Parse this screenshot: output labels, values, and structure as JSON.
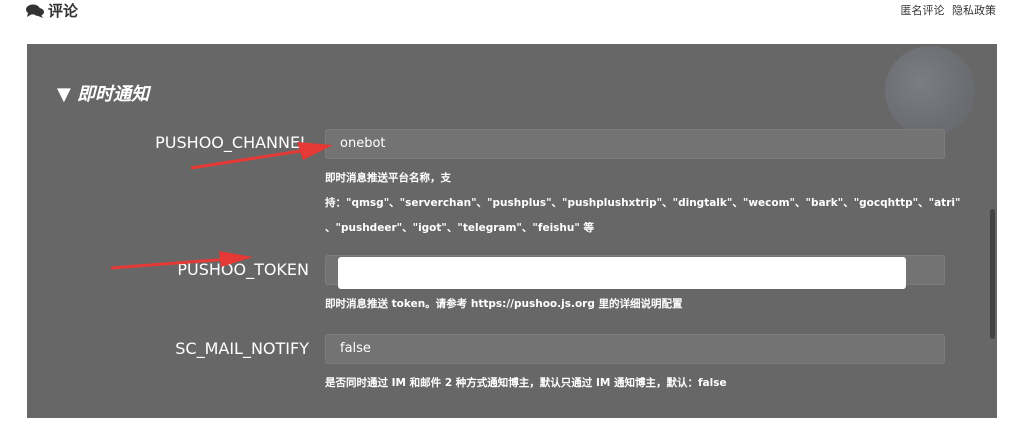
{
  "header": {
    "title": "评论",
    "title_icon": "comments-icon",
    "links": [
      "匿名评论",
      "隐私政策"
    ]
  },
  "section": {
    "title": "▼ 即时通知"
  },
  "fields": {
    "channel": {
      "label": "PUSHOO_CHANNEL",
      "value": "onebot",
      "help_line1": "即时消息推送平台名称，支",
      "help_line2": "持：\"qmsg\"、\"serverchan\"、\"pushplus\"、\"pushplushxtrip\"、\"dingtalk\"、\"wecom\"、\"bark\"、\"gocqhttp\"、\"atri\"",
      "help_line3": "、\"pushdeer\"、\"igot\"、\"telegram\"、\"feishu\" 等"
    },
    "token": {
      "label": "PUSHOO_TOKEN",
      "value": "",
      "help": "即时消息推送 token。请参考 https://pushoo.js.org 里的详细说明配置"
    },
    "mail_notify": {
      "label": "SC_MAIL_NOTIFY",
      "value": "false",
      "help": "是否同时通过 IM 和邮件 2 种方式通知博主，默认只通过 IM 通知博主，默认：false"
    }
  },
  "colors": {
    "overlay": "#676767",
    "annotation_arrow": "#e53935"
  }
}
